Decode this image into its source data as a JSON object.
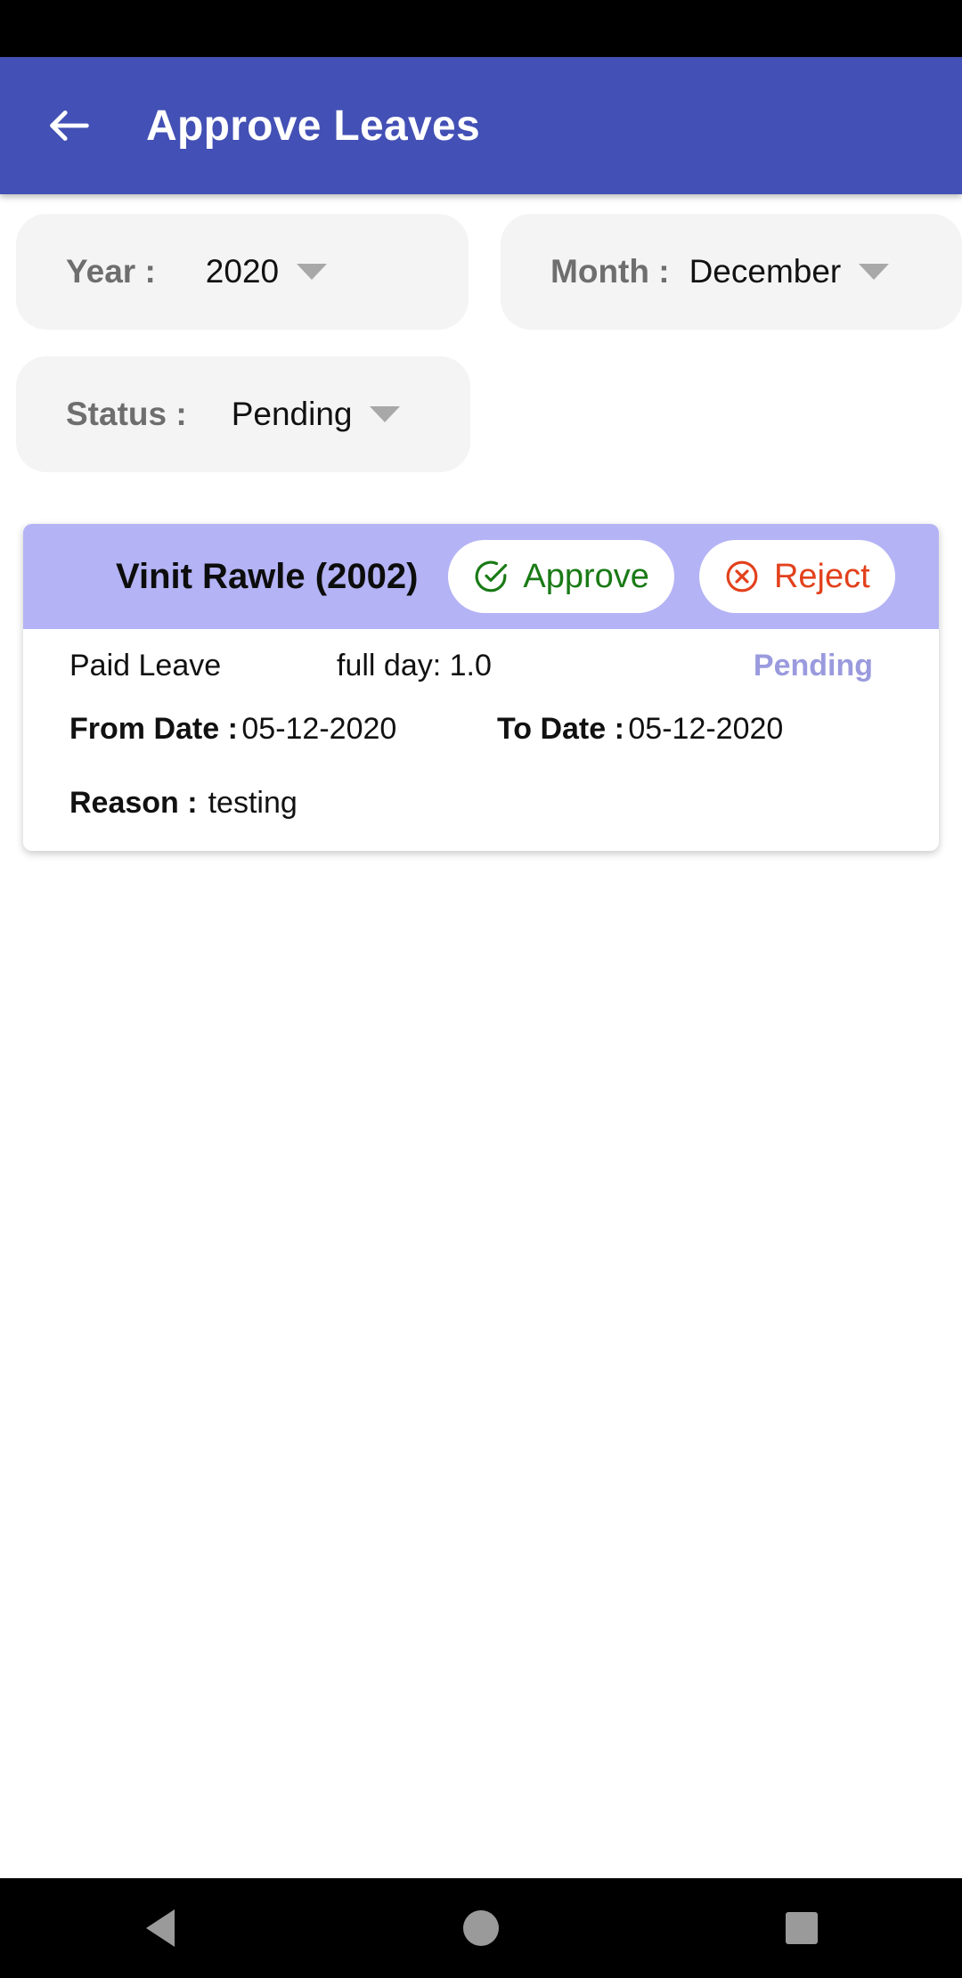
{
  "app_bar": {
    "back_icon": "arrow-left-icon",
    "title": "Approve Leaves"
  },
  "filters": [
    {
      "id": "year",
      "label": "Year :",
      "value": "2020",
      "caret": "chevron-down-icon"
    },
    {
      "id": "month",
      "label": "Month :",
      "value": "December",
      "caret": "chevron-down-icon"
    },
    {
      "id": "status",
      "label": "Status :",
      "value": "Pending",
      "caret": "chevron-down-icon"
    }
  ],
  "leave_cards": [
    {
      "employee": "Vinit Rawle (2002)",
      "approve_label": "Approve",
      "approve_icon": "check-circle-icon",
      "reject_label": "Reject",
      "reject_icon": "close-circle-icon",
      "leave_type": "Paid Leave",
      "duration": "full day: 1.0",
      "status": "Pending",
      "from_label": "From Date :",
      "from_date": "05-12-2020",
      "to_label": "To Date :",
      "to_date": "05-12-2020",
      "reason_label": "Reason :",
      "reason": "testing"
    }
  ],
  "nav_bar": {
    "back": "triangle-back-icon",
    "home": "circle-home-icon",
    "recents": "square-recents-icon"
  },
  "colors": {
    "app_bar": "#4350b5",
    "chip_bg": "#f4f4f4",
    "card_head": "#b4b3f5",
    "approve": "#1a7a16",
    "reject": "#e2411c",
    "status": "#9a9ade"
  }
}
